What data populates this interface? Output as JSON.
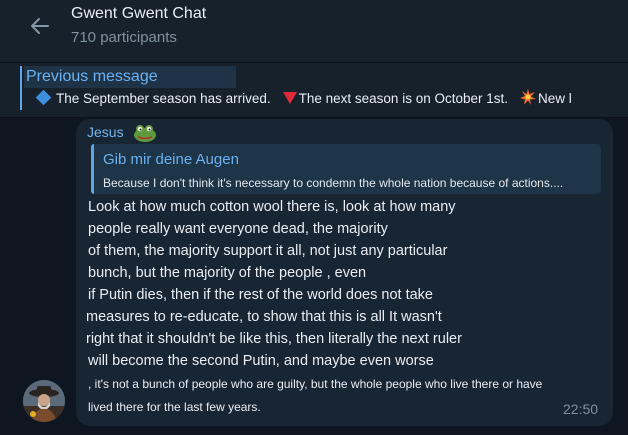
{
  "header": {
    "title": "Gwent Gwent Chat",
    "participants": "710 participants"
  },
  "pinned": {
    "label": "Previous message",
    "text_1": "The September season has arrived.",
    "text_2": "The next season is on October 1st.",
    "text_3": "New l"
  },
  "message": {
    "sender": "Jesus",
    "reply": {
      "name": "Gib mir deine Augen",
      "text": "Because I don't think it's necessary to condemn the whole nation because of actions...."
    },
    "lines": [
      "Look at how much cotton wool there is, look at how many",
      "people really want everyone dead, the majority",
      "of them, the majority support it all, not just any particular",
      "bunch, but the majority of the people , even",
      "if Putin dies, then if the rest of the world does not take",
      "measures to re-educate, to show that this is all It wasn't",
      "right that it shouldn't be like this, then literally the next ruler",
      "will become the second Putin, and maybe even worse",
      ", it's not a bunch of people who are guilty, but the whole people who live there or have",
      "lived there for the last few years."
    ],
    "time": "22:50"
  },
  "icons": {
    "back": "arrow-left-icon",
    "pinned_1": "blue-diamond-icon",
    "pinned_2": "red-triangle-icon",
    "pinned_3": "collision-icon",
    "sender_emoji": "frog-emoji-icon"
  },
  "colors": {
    "background": "#0e1621",
    "header": "#17212b",
    "bubble": "#182533",
    "accent": "#6ab2f2",
    "muted": "#7f919e"
  }
}
